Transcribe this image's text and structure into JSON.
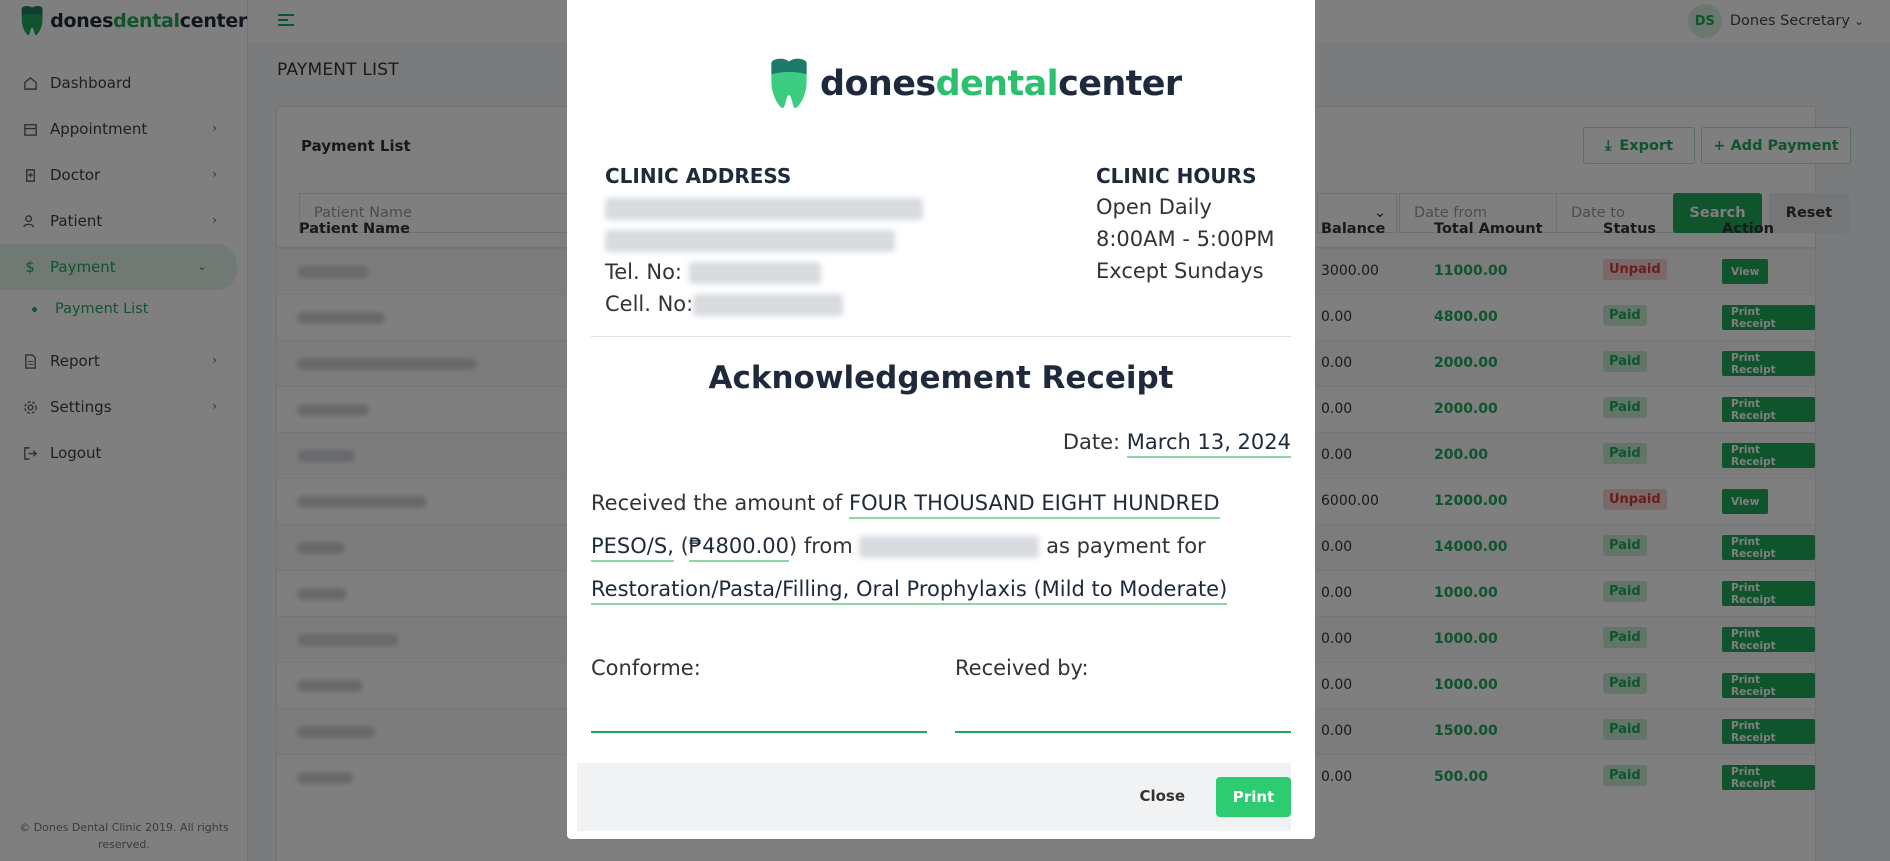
{
  "brand": {
    "part1": "dones",
    "part2": "dental",
    "part3": "center"
  },
  "sidebar": {
    "items": [
      {
        "label": "Dashboard"
      },
      {
        "label": "Appointment"
      },
      {
        "label": "Doctor"
      },
      {
        "label": "Patient"
      },
      {
        "label": "Payment"
      },
      {
        "label": "Payment List"
      },
      {
        "label": "Report"
      },
      {
        "label": "Settings"
      },
      {
        "label": "Logout"
      }
    ],
    "footer": "© Dones Dental Clinic 2019. All rights reserved."
  },
  "topbar": {
    "user_initials": "DS",
    "user_name": "Dones Secretary"
  },
  "page": {
    "title": "PAYMENT LIST",
    "card_title": "Payment List",
    "export_label": "Export",
    "add_label": "+ Add Payment",
    "filters": {
      "patient_placeholder": "Patient Name",
      "date_from": "Date from",
      "date_to": "Date to"
    },
    "search_label": "Search",
    "reset_label": "Reset",
    "columns": [
      "Patient Name",
      "Balance",
      "Total Amount",
      "Status",
      "Action"
    ],
    "rows": [
      {
        "balance": "3000.00",
        "total": "11000.00",
        "status": "Unpaid",
        "action": "View"
      },
      {
        "balance": "0.00",
        "total": "4800.00",
        "status": "Paid",
        "action": "Print Receipt"
      },
      {
        "balance": "0.00",
        "total": "2000.00",
        "status": "Paid",
        "action": "Print Receipt"
      },
      {
        "balance": "0.00",
        "total": "2000.00",
        "status": "Paid",
        "action": "Print Receipt"
      },
      {
        "balance": "0.00",
        "total": "200.00",
        "status": "Paid",
        "action": "Print Receipt"
      },
      {
        "balance": "6000.00",
        "total": "12000.00",
        "status": "Unpaid",
        "action": "View"
      },
      {
        "balance": "0.00",
        "total": "14000.00",
        "status": "Paid",
        "action": "Print Receipt"
      },
      {
        "balance": "0.00",
        "total": "1000.00",
        "status": "Paid",
        "action": "Print Receipt"
      },
      {
        "balance": "0.00",
        "total": "1000.00",
        "status": "Paid",
        "action": "Print Receipt"
      },
      {
        "balance": "0.00",
        "total": "1000.00",
        "status": "Paid",
        "action": "Print Receipt"
      },
      {
        "balance": "0.00",
        "total": "1500.00",
        "status": "Paid",
        "action": "Print Receipt"
      },
      {
        "balance": "0.00",
        "total": "500.00",
        "status": "Paid",
        "action": "Print Receipt"
      }
    ]
  },
  "modal": {
    "address_title": "CLINIC ADDRESS",
    "tel_label": "Tel. No:",
    "cell_label": "Cell. No:",
    "hours_title": "CLINIC HOURS",
    "hours": [
      "Open Daily",
      "8:00AM - 5:00PM",
      "Except Sundays"
    ],
    "receipt_title": "Acknowledgement Receipt",
    "date_label": "Date:",
    "date_value": "March 13, 2024",
    "received_text": "Received the amount of",
    "amount_words": "FOUR THOUSAND EIGHT HUNDRED PESO/S,",
    "amount_open": "(",
    "amount_value": "₱4800.00",
    "amount_close": ")",
    "from_text": "from",
    "payment_for_text": "as payment for",
    "services": "Restoration/Pasta/Filling, Oral Prophylaxis (Mild to Moderate)",
    "conforme_label": "Conforme:",
    "received_by_label": "Received by:",
    "close_label": "Close",
    "print_label": "Print"
  },
  "colors": {
    "brand_green": "#1fa85b",
    "unpaid_red": "#d23b3b",
    "print_green": "#2ecc71"
  }
}
